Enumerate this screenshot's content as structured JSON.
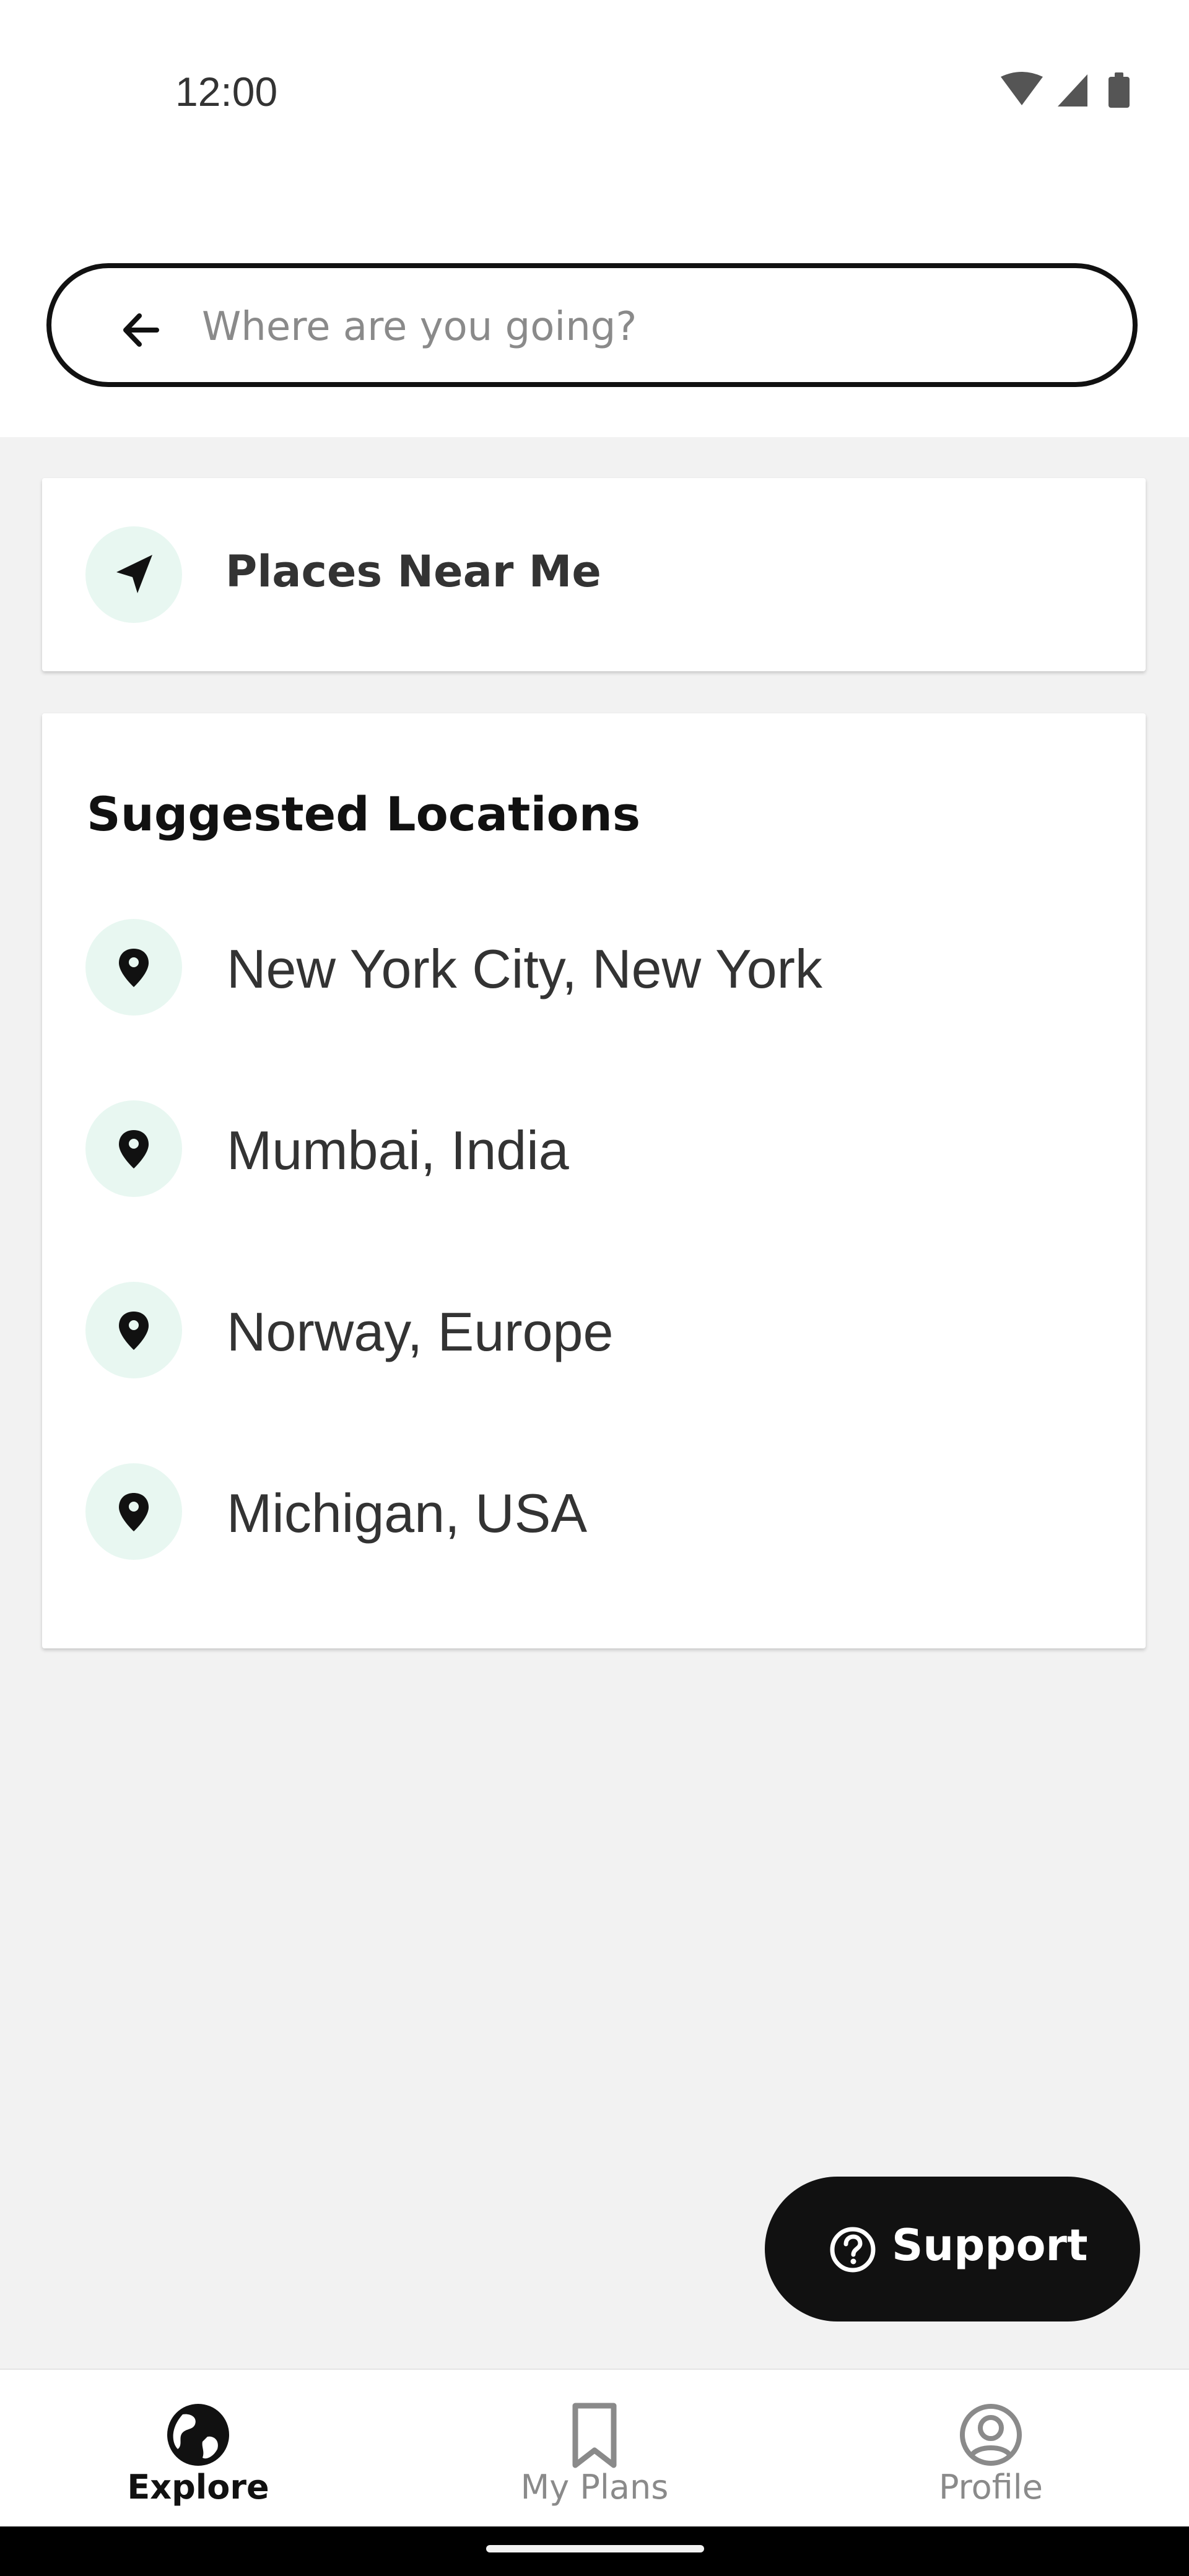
{
  "status_bar": {
    "time": "12:00",
    "icons": [
      "wifi-icon",
      "cellular-signal-icon",
      "battery-icon"
    ]
  },
  "search": {
    "placeholder": "Where are you going?",
    "value": "",
    "back_icon": "arrow-left-icon"
  },
  "nearby": {
    "label": "Places Near Me",
    "icon": "navigation-arrow-icon"
  },
  "suggested": {
    "title": "Suggested Locations",
    "items": [
      {
        "label": "New York City, New York",
        "icon": "map-pin-icon"
      },
      {
        "label": "Mumbai, India",
        "icon": "map-pin-icon"
      },
      {
        "label": "Norway, Europe",
        "icon": "map-pin-icon"
      },
      {
        "label": "Michigan, USA",
        "icon": "map-pin-icon"
      }
    ]
  },
  "support": {
    "label": "Support",
    "icon": "question-circle-icon"
  },
  "bottom_nav": {
    "items": [
      {
        "label": "Explore",
        "icon": "globe-icon",
        "active": true
      },
      {
        "label": "My Plans",
        "icon": "bookmark-icon",
        "active": false
      },
      {
        "label": "Profile",
        "icon": "user-circle-icon",
        "active": false
      }
    ]
  },
  "colors": {
    "icon_circle_bg": "#e8f7f1",
    "page_bg": "#f2f2f2",
    "dark": "#111111",
    "inactive": "#8a8a8a"
  }
}
